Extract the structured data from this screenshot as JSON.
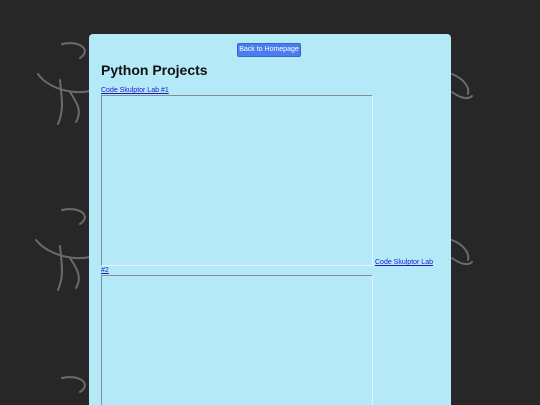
{
  "page": {
    "background_color": "#262726",
    "panel_color": "#b4eaf7",
    "accent_button_color": "#4a7ef0"
  },
  "header": {
    "back_button_label": "Back to Homepage"
  },
  "main": {
    "title": "Python Projects",
    "projects": [
      {
        "link_text": "Code Skulptor Lab #1"
      },
      {
        "link_text_line1": "Code Skulptor Lab",
        "link_text_line2": "#2"
      }
    ]
  }
}
